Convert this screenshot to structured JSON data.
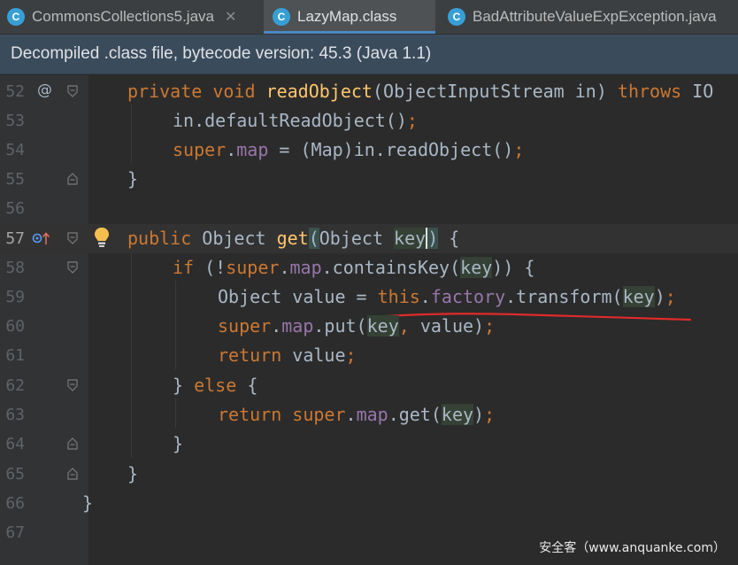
{
  "tabs": [
    {
      "label": "CommonsCollections5.java",
      "icon": "class-icon",
      "close": "✕",
      "active": false
    },
    {
      "label": "LazyMap.class",
      "icon": "class-icon",
      "active": true
    },
    {
      "label": "BadAttributeValueExpException.java",
      "icon": "class-icon",
      "active": false
    }
  ],
  "banner": "Decompiled .class file, bytecode version: 45.3 (Java 1.1)",
  "gutter_markers": {
    "override": "@"
  },
  "lines": [
    {
      "num": "52"
    },
    {
      "num": "53"
    },
    {
      "num": "54"
    },
    {
      "num": "55"
    },
    {
      "num": "56"
    },
    {
      "num": "57"
    },
    {
      "num": "58"
    },
    {
      "num": "59"
    },
    {
      "num": "60"
    },
    {
      "num": "61"
    },
    {
      "num": "62"
    },
    {
      "num": "63"
    },
    {
      "num": "64"
    },
    {
      "num": "65"
    },
    {
      "num": "66"
    },
    {
      "num": "67"
    }
  ],
  "tokens": {
    "private": "private",
    "void": "void",
    "readObject": "readObject",
    "sig52": "(ObjectInputStream in) ",
    "throws": "throws",
    "io": "IO",
    "in_default": "in.defaultReadObject()",
    "semi": ";",
    "super": "super",
    "dot": ".",
    "map": "map",
    "assign54": " = (Map)in.readObject()",
    "rbrace": "}",
    "lbrace": "{",
    "public": "public",
    "object": " Object ",
    "get": "get",
    "lparen": "(",
    "rparen": ")",
    "objectSp": "Object ",
    "key": "key",
    "ke": "ke",
    "y": "y",
    "if": "if",
    "notOpen": " (!",
    "containsKey": ".containsKey(",
    "closeBr": ")) {",
    "objValue": "Object value = ",
    "this": "this",
    "factory": "factory",
    "transform": ".transform(",
    "put": ".put(",
    "comma": ",",
    "value": " value",
    "closeParen": ")",
    "return": "return",
    "valueWord": " value",
    "else": "else",
    "getCall": ".get("
  },
  "watermark": "安全客（www.anquanke.com）",
  "colors": {
    "keyword": "#cc7832",
    "method": "#ffc66d",
    "field": "#9876aa",
    "text": "#a9b7c6",
    "underline": "#e02b2b"
  }
}
